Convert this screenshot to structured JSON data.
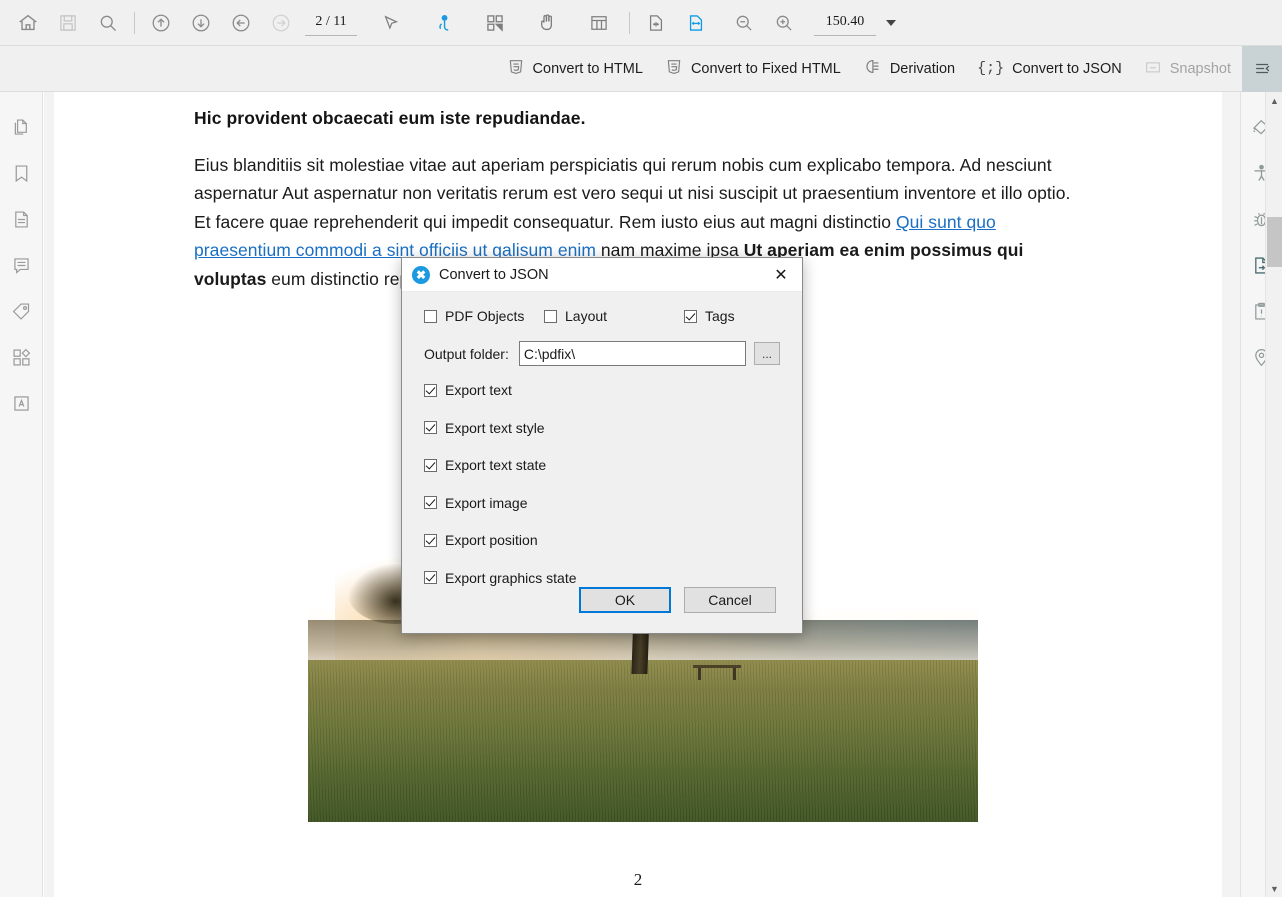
{
  "toolbar": {
    "buttons": [
      {
        "name": "home-icon",
        "title": "Home"
      },
      {
        "name": "save-icon",
        "title": "Save"
      },
      {
        "name": "search-icon",
        "title": "Search"
      },
      {
        "name": "first-page-icon",
        "title": "First page"
      },
      {
        "name": "last-page-icon",
        "title": "Last page"
      },
      {
        "name": "previous-page-icon",
        "title": "Previous page"
      },
      {
        "name": "next-page-icon",
        "title": "Next page"
      }
    ],
    "page_value": "2 / 11",
    "page_current": "2",
    "page_total": "11",
    "tools": [
      {
        "name": "select-cursor-icon",
        "title": "Select"
      },
      {
        "name": "hand-pointer-icon",
        "title": "Pointer"
      },
      {
        "name": "grid-select-icon",
        "title": "Zone select"
      },
      {
        "name": "pan-hand-icon",
        "title": "Pan"
      },
      {
        "name": "table-icon",
        "title": "Table"
      },
      {
        "name": "fit-page-icon",
        "title": "Fit page"
      },
      {
        "name": "fit-width-icon",
        "title": "Fit width"
      },
      {
        "name": "zoom-out-icon",
        "title": "Zoom out"
      },
      {
        "name": "zoom-in-icon",
        "title": "Zoom in"
      }
    ],
    "zoom_value": "150.40"
  },
  "subtoolbar": {
    "items": [
      {
        "label": "Convert to HTML",
        "icon": "html5-icon",
        "disabled": false
      },
      {
        "label": "Convert to Fixed HTML",
        "icon": "html5-icon",
        "disabled": false
      },
      {
        "label": "Derivation",
        "icon": "derivation-icon",
        "disabled": false
      },
      {
        "label": "Convert to JSON",
        "icon": "json-braces-icon",
        "disabled": false
      },
      {
        "label": "Snapshot",
        "icon": "snapshot-icon",
        "disabled": true
      }
    ],
    "collapse_icon": "collapse-panel-icon"
  },
  "left_rail": {
    "items": [
      {
        "name": "pages-icon",
        "title": "Pages"
      },
      {
        "name": "bookmark-icon",
        "title": "Bookmarks"
      },
      {
        "name": "document-icon",
        "title": "Document"
      },
      {
        "name": "comments-icon",
        "title": "Comments"
      },
      {
        "name": "tag-icon",
        "title": "Tags"
      },
      {
        "name": "layout-grid-icon",
        "title": "Layout"
      },
      {
        "name": "text-a-icon",
        "title": "Text"
      }
    ]
  },
  "right_rail": {
    "items": [
      {
        "name": "rotate-pages-icon",
        "title": "Rotate"
      },
      {
        "name": "accessibility-icon",
        "title": "Accessibility"
      },
      {
        "name": "bug-icon",
        "title": "Debug"
      },
      {
        "name": "export-document-icon",
        "title": "Export",
        "active": true
      },
      {
        "name": "clipboard-alert-icon",
        "title": "Issues"
      },
      {
        "name": "location-pin-icon",
        "title": "Location"
      }
    ]
  },
  "document": {
    "heading": "Hic provident obcaecati eum iste repudiandae.",
    "paragraph_part1": "Eius blanditiis sit molestiae vitae aut aperiam perspiciatis qui rerum nobis cum explicabo tempora. Ad nesciunt aspernatur Aut aspernatur non veritatis rerum est vero sequi ut nisi suscipit ut praesentium inventore et illo optio. Et facere quae reprehenderit qui impedit consequatur. Rem iusto eius aut magni distinctio ",
    "link_text": "Qui sunt quo praesentium commodi a sint officiis ut galisum enim",
    "paragraph_part2": " nam maxime ipsa ",
    "bold_text": "Ut aperiam ea enim possimus qui voluptas",
    "paragraph_part3": " eum distinctio reprehenderit.",
    "page_number": "2",
    "image_alt": "misty-sunrise-field-with-tree"
  },
  "dialog": {
    "title": "Convert to JSON",
    "icon": "pdfix-logo-icon",
    "close_label": "✕",
    "top_options": [
      {
        "label": "PDF Objects",
        "checked": false
      },
      {
        "label": "Layout",
        "checked": false
      },
      {
        "label": "Tags",
        "checked": true
      }
    ],
    "output_folder_label": "Output folder:",
    "output_folder_value": "C:\\pdfix\\",
    "browse_label": "...",
    "export_options": [
      {
        "label": "Export text",
        "checked": true
      },
      {
        "label": "Export text style",
        "checked": true
      },
      {
        "label": "Export text state",
        "checked": true
      },
      {
        "label": "Export image",
        "checked": true
      },
      {
        "label": "Export position",
        "checked": true
      },
      {
        "label": "Export graphics state",
        "checked": true
      }
    ],
    "ok_label": "OK",
    "cancel_label": "Cancel"
  },
  "colors": {
    "accent": "#0078d7",
    "link": "#1a6fc4",
    "toolbar_bg": "#f0f0f0",
    "active_tool": "#1b9ae0"
  }
}
